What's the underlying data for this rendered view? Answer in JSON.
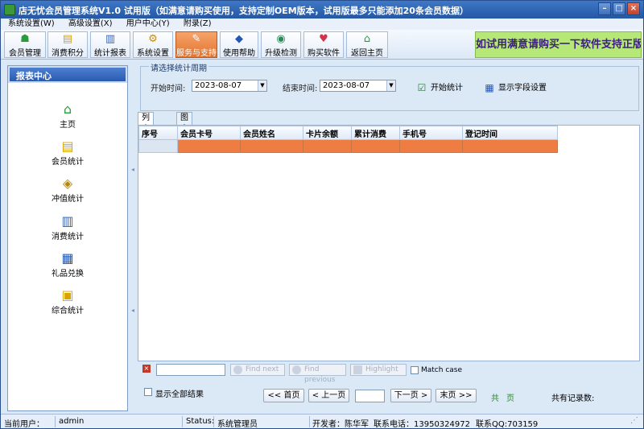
{
  "window": {
    "title": "店无忧会员管理系统V1.0 试用版（如满意请购买使用，支持定制OEM版本，试用版最多只能添加20条会员数据）",
    "controls": [
      "minimize",
      "maximize",
      "close"
    ]
  },
  "menu": [
    "系统设置(W)",
    "高级设置(X)",
    "用户中心(Y)",
    "附录(Z)"
  ],
  "toolbar": {
    "items": [
      {
        "label": "会员管理",
        "icon": "members-icon"
      },
      {
        "label": "消费积分",
        "icon": "points-icon"
      },
      {
        "label": "统计报表",
        "icon": "report-icon"
      },
      {
        "label": "系统设置",
        "icon": "settings-icon"
      },
      {
        "label": "服务与支持",
        "icon": "support-icon"
      },
      {
        "label": "使用帮助",
        "icon": "help-icon"
      },
      {
        "label": "升级检测",
        "icon": "upgrade-icon"
      },
      {
        "label": "购买软件",
        "icon": "buy-icon"
      },
      {
        "label": "返回主页",
        "icon": "home-icon"
      }
    ],
    "active_index": 4,
    "banner": "如试用满意请购买一下软件支持正版哦"
  },
  "sidebar": {
    "title": "报表中心",
    "items": [
      {
        "label": "主页",
        "icon": "home-icon"
      },
      {
        "label": "会员统计",
        "icon": "member-stats-icon"
      },
      {
        "label": "冲值统计",
        "icon": "recharge-stats-icon"
      },
      {
        "label": "消费统计",
        "icon": "consume-stats-icon"
      },
      {
        "label": "礼品兑换",
        "icon": "gift-exchange-icon"
      },
      {
        "label": "综合统计",
        "icon": "summary-stats-icon"
      }
    ]
  },
  "period": {
    "legend": "请选择统计周期",
    "start_label": "开始时间:",
    "start_value": "2023-08-07",
    "end_label": "结束时间:",
    "end_value": "2023-08-07",
    "start_button": "开始统计",
    "fields_button": "显示字段设置"
  },
  "tabs": [
    {
      "label": "列表分析",
      "selected": true
    },
    {
      "label": "图表分析",
      "selected": false
    }
  ],
  "grid": {
    "columns": [
      "序号",
      "会员卡号",
      "会员姓名",
      "卡片余额",
      "累计消费",
      "手机号",
      "登记时间"
    ],
    "rows": [
      [
        "",
        "",
        "",
        "",
        "",
        "",
        ""
      ]
    ]
  },
  "find": {
    "query": "",
    "next_label": "Find next",
    "prev_label": "Find previous",
    "highlight_label": "Highlight",
    "match_case_label": "Match case"
  },
  "pager": {
    "show_all_label": "显示全部结果",
    "first": "<< 首页",
    "prev": "< 上一页",
    "page_value": "",
    "next": "下一页 >",
    "last": "末页 >>",
    "total_prefix": "共",
    "total_suffix": "页",
    "records_label": "共有记录数:"
  },
  "status": {
    "user_label": "当前用户：",
    "user_value": "admin",
    "status_label": "Status:",
    "status_value": "系统管理员",
    "developer": "开发者：陈华军",
    "phone": "联系电话：13950324972",
    "qq": "联系QQ:703159"
  },
  "colors": {
    "selected_row": "#ee7d43",
    "title_bar": "#2e62b0",
    "active_tool": "#e0742f",
    "banner_bg": "#b6e877"
  }
}
